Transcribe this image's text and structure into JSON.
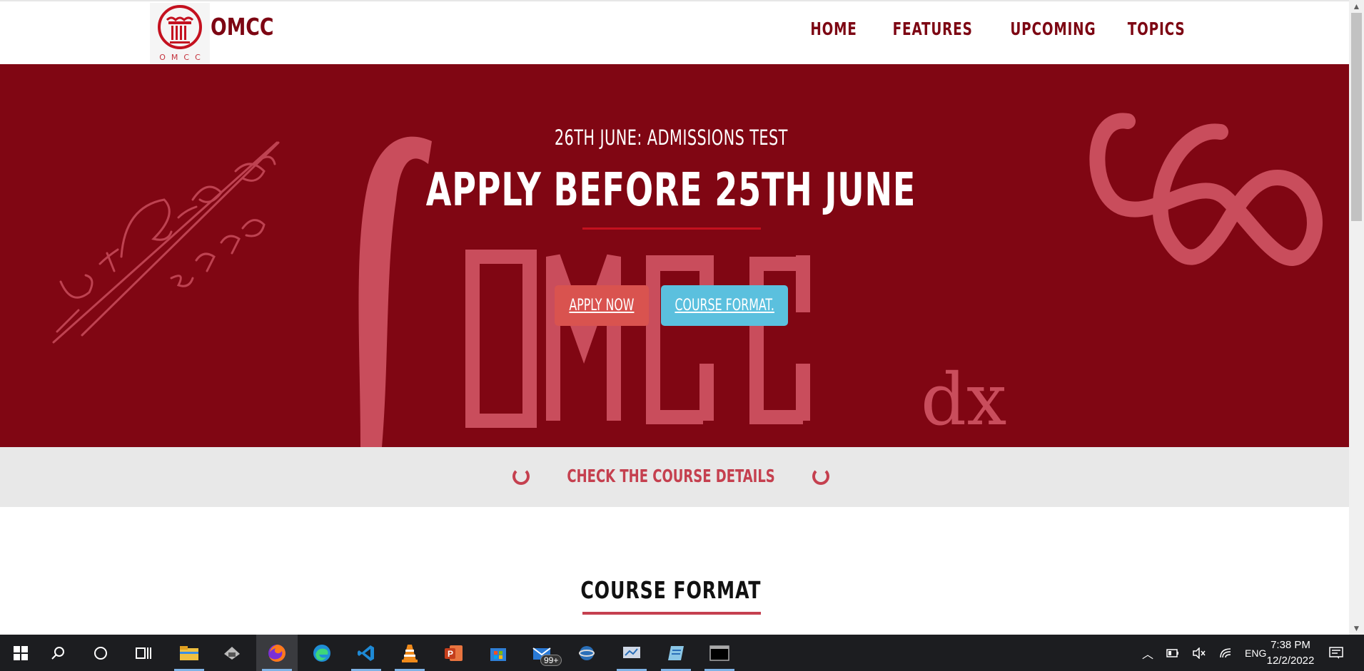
{
  "brand": {
    "name": "OMCC",
    "logo_caption": "OMCC"
  },
  "nav": {
    "items": [
      "HOME",
      "FEATURES",
      "UPCOMING",
      "TOPICS"
    ]
  },
  "hero": {
    "subtitle": "26TH JUNE: ADMISSIONS TEST",
    "title": "APPLY BEFORE 25TH JUNE",
    "apply_button": "APPLY NOW",
    "format_button": "COURSE FORMAT.",
    "watermark_text": "OMCC",
    "watermark_suffix": "dx",
    "colors": {
      "background": "#800613",
      "watermark": "#c94d5c",
      "apply": "#d9534f",
      "format": "#5bc0de"
    }
  },
  "strip": {
    "label": "CHECK THE COURSE DETAILS"
  },
  "section": {
    "title": "COURSE FORMAT"
  },
  "taskbar": {
    "apps": [
      "start-icon",
      "search-icon",
      "cortana-icon",
      "task-view-icon",
      "file-explorer-icon",
      "app-icon",
      "firefox-icon",
      "edge-icon",
      "vscode-icon",
      "vlc-icon",
      "powerpoint-icon",
      "store-icon",
      "mail-icon",
      "globe-icon",
      "app-icon",
      "notepad-icon",
      "terminal-icon"
    ],
    "mail_badge": "99+",
    "language": "ENG",
    "time": "7:38 PM",
    "date": "12/2/2022"
  }
}
